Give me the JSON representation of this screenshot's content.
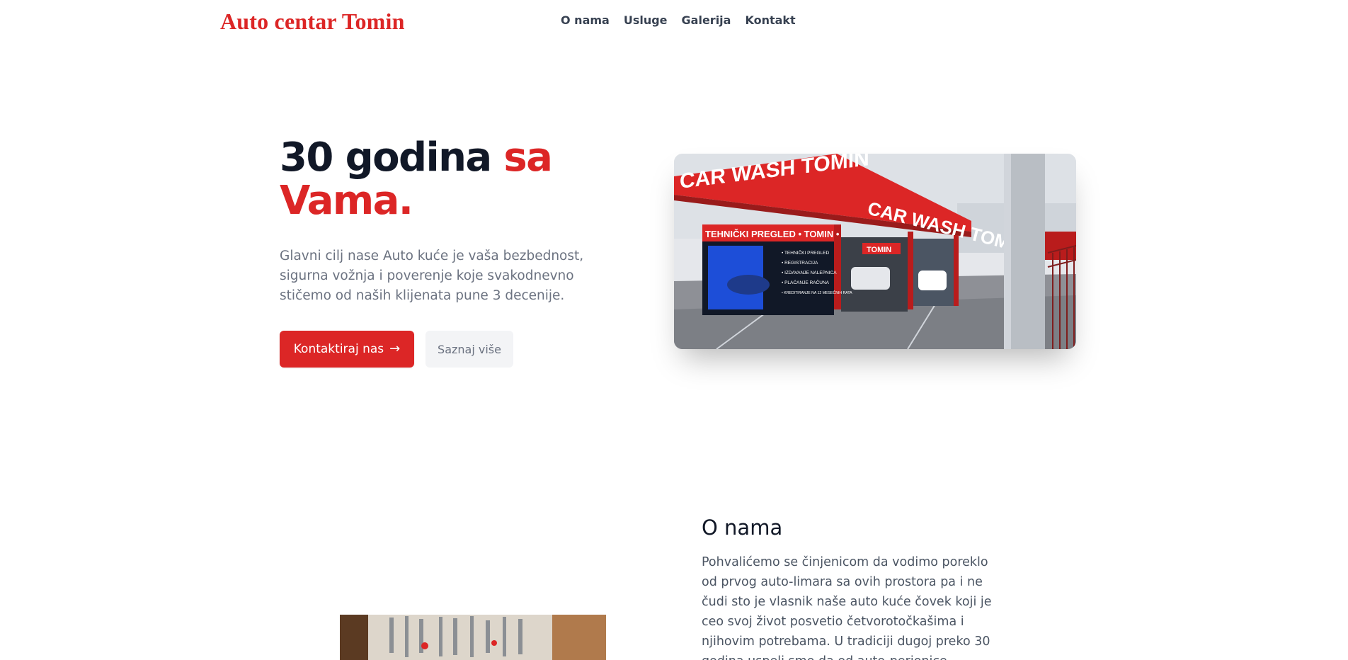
{
  "header": {
    "brand": "Auto centar Tomin",
    "nav": [
      "O nama",
      "Usluge",
      "Galerija",
      "Kontakt"
    ]
  },
  "hero": {
    "title_dark": "30 godina ",
    "title_accent_1": "sa",
    "title_accent_2": "Vama.",
    "description": "Glavni cilj nase Auto kuće je vaša bezbednost, sigurna vožnja i poverenje koje svakodnevno stičemo od naših klijenata pune 3 decenije.",
    "primary_button": "Kontaktiraj nas",
    "secondary_button": "Saznaj više",
    "image_sign": {
      "roof_left": "CAR WASH TOMIN",
      "roof_right": "CAR WASH TOMIN",
      "banner": "TEHNIČKI PREGLED • TOMIN •",
      "list": [
        "• TEHNIČKI PREGLED",
        "• REGISTRACIJA",
        "• IZDAVANJE NALEPNICA",
        "• PLAĆANJE RAČUNA",
        "• KREDITIRANJE NA 12 MESEČNIH RATA"
      ],
      "bay_sign": "TOMIN"
    }
  },
  "about": {
    "title": "O nama",
    "text": "Pohvalićemo se činjenicom da vodimo poreklo od prvog auto-limara sa ovih prostora pa i ne čudi sto je vlasnik naše auto kuće čovek koji je ceo svoj život posvetio četvorotočkašima i njihovim potrebama. U tradiciji dugoj preko 30 godina uspeli smo da od auto-perionice proširimo"
  },
  "colors": {
    "accent": "#dc2626",
    "heading": "#111827",
    "muted": "#6b7280",
    "secondary_bg": "#f3f4f6"
  },
  "icons": {
    "primary_button": "arrow-right-icon"
  }
}
